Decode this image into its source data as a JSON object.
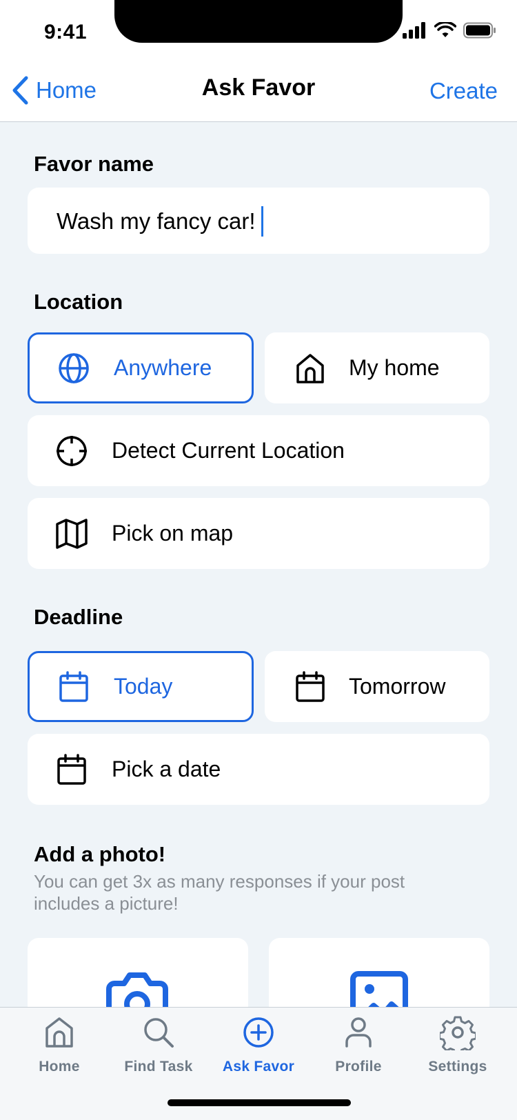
{
  "status": {
    "time": "9:41"
  },
  "nav": {
    "back_label": "Home",
    "title": "Ask Favor",
    "action_label": "Create"
  },
  "favor": {
    "section_label": "Favor name",
    "value": "Wash my fancy car!"
  },
  "location": {
    "section_label": "Location",
    "options": [
      {
        "label": "Anywhere",
        "icon": "globe-icon",
        "selected": true
      },
      {
        "label": "My home",
        "icon": "house-icon",
        "selected": false
      },
      {
        "label": "Detect Current Location",
        "icon": "crosshair-icon",
        "selected": false
      },
      {
        "label": "Pick on map",
        "icon": "map-icon",
        "selected": false
      }
    ]
  },
  "deadline": {
    "section_label": "Deadline",
    "options": [
      {
        "label": "Today",
        "icon": "calendar-icon",
        "selected": true
      },
      {
        "label": "Tomorrow",
        "icon": "calendar-icon",
        "selected": false
      },
      {
        "label": "Pick a date",
        "icon": "calendar-icon",
        "selected": false
      }
    ]
  },
  "photo": {
    "section_label": "Add a photo!",
    "subtitle": "You can get 3x as many responses if your post includes a picture!",
    "options": [
      {
        "icon": "camera-icon"
      },
      {
        "icon": "image-icon"
      }
    ]
  },
  "tabs": [
    {
      "label": "Home",
      "icon": "home-tab-icon",
      "active": false
    },
    {
      "label": "Find Task",
      "icon": "search-icon",
      "active": false
    },
    {
      "label": "Ask Favor",
      "icon": "plus-circle-icon",
      "active": true
    },
    {
      "label": "Profile",
      "icon": "person-icon",
      "active": false
    },
    {
      "label": "Settings",
      "icon": "gear-icon",
      "active": false
    }
  ],
  "colors": {
    "accent": "#1E66E0",
    "link": "#1E74E6",
    "background": "#EFF4F8",
    "tab_inactive": "#6E7A86"
  }
}
